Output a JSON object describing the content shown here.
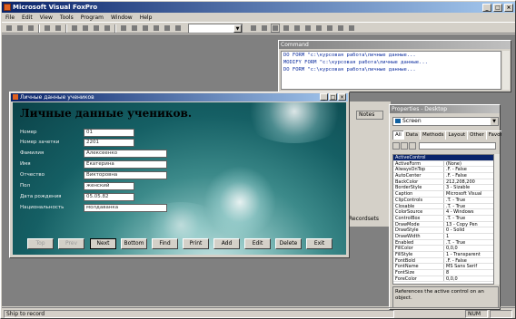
{
  "app": {
    "title": "Microsoft Visual FoxPro"
  },
  "menu": [
    "File",
    "Edit",
    "View",
    "Tools",
    "Program",
    "Window",
    "Help"
  ],
  "command_window": {
    "title": "Command",
    "lines": [
      "DO FORM \"c:\\курсовая работа\\личные данные...",
      "MODIFY FORM \"c:\\курсовая работа\\личные данные...",
      "DO FORM \"c:\\курсовая работа\\личные данные..."
    ]
  },
  "form": {
    "window_title": "Личные данные учеников",
    "heading": "Личные данные учеников.",
    "fields": [
      {
        "label": "Номер",
        "value": "01"
      },
      {
        "label": "Номер зачетки",
        "value": "2201"
      },
      {
        "label": "Фамилия",
        "value": "Алексеенко"
      },
      {
        "label": "Имя",
        "value": "Екатерина"
      },
      {
        "label": "Отчество",
        "value": "Викторовна"
      },
      {
        "label": "Пол",
        "value": "женский"
      },
      {
        "label": "Дата рождения",
        "value": "05.05.82"
      },
      {
        "label": "Национальность",
        "value": "молдаванка"
      }
    ],
    "buttons": [
      {
        "label": "Top",
        "disabled": true
      },
      {
        "label": "Prev",
        "disabled": true
      },
      {
        "label": "Next",
        "disabled": false,
        "default": true
      },
      {
        "label": "Bottom",
        "disabled": false
      },
      {
        "label": "Find",
        "disabled": false
      },
      {
        "label": "Print",
        "disabled": false
      },
      {
        "label": "Add",
        "disabled": false
      },
      {
        "label": "Edit",
        "disabled": false
      },
      {
        "label": "Delete",
        "disabled": false
      },
      {
        "label": "Exit",
        "disabled": false
      }
    ]
  },
  "properties": {
    "title": "Properties - Desktop",
    "object": "Screen",
    "tabs": [
      "All",
      "Data",
      "Methods",
      "Layout",
      "Other",
      "Favorites"
    ],
    "rows": [
      {
        "name": "ActiveControl",
        "value": ""
      },
      {
        "name": "ActiveForm",
        "value": "(None)"
      },
      {
        "name": "AlwaysOnTop",
        "value": ".F. - False"
      },
      {
        "name": "AutoCenter",
        "value": ".F. - False"
      },
      {
        "name": "BackColor",
        "value": "212,208,200"
      },
      {
        "name": "BorderStyle",
        "value": "3 - Sizable"
      },
      {
        "name": "Caption",
        "value": "Microsoft Visual"
      },
      {
        "name": "ClipControls",
        "value": ".T. - True"
      },
      {
        "name": "Closable",
        "value": ".T. - True"
      },
      {
        "name": "ColorSource",
        "value": "4 - Windows"
      },
      {
        "name": "ControlBox",
        "value": ".T. - True"
      },
      {
        "name": "DrawMode",
        "value": "13 - Copy Pen"
      },
      {
        "name": "DrawStyle",
        "value": "0 - Solid"
      },
      {
        "name": "DrawWidth",
        "value": "1"
      },
      {
        "name": "Enabled",
        "value": ".T. - True"
      },
      {
        "name": "FillColor",
        "value": "0,0,0"
      },
      {
        "name": "FillStyle",
        "value": "1 - Transparent"
      },
      {
        "name": "FontBold",
        "value": ".F. - False"
      },
      {
        "name": "FontName",
        "value": "MS Sans Serif"
      },
      {
        "name": "FontSize",
        "value": "8"
      },
      {
        "name": "ForeColor",
        "value": "0,0,0"
      }
    ],
    "description": "References the active control on an object."
  },
  "side_tab": {
    "label": "Notes"
  },
  "side_status": {
    "label": "Recordsets"
  },
  "status": {
    "left": "Ship to record",
    "num": "NUM"
  }
}
